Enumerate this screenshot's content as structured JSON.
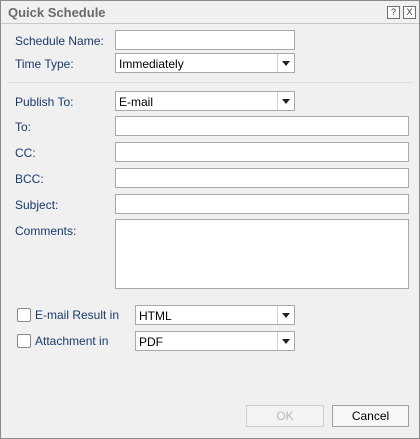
{
  "dialog": {
    "title": "Quick Schedule",
    "help_label": "?",
    "close_label": "X"
  },
  "form": {
    "schedule_name_label": "Schedule Name:",
    "schedule_name_value": "",
    "time_type_label": "Time Type:",
    "time_type_value": "Immediately",
    "publish_to_label": "Publish To:",
    "publish_to_value": "E-mail",
    "to_label": "To:",
    "cc_label": "CC:",
    "bcc_label": "BCC:",
    "subject_label": "Subject:",
    "comments_label": "Comments:",
    "email_result_label": "E-mail Result in",
    "email_result_value": "HTML",
    "email_result_checked": false,
    "attachment_label": "Attachment in",
    "attachment_value": "PDF",
    "attachment_checked": false
  },
  "buttons": {
    "ok_label": "OK",
    "cancel_label": "Cancel"
  }
}
